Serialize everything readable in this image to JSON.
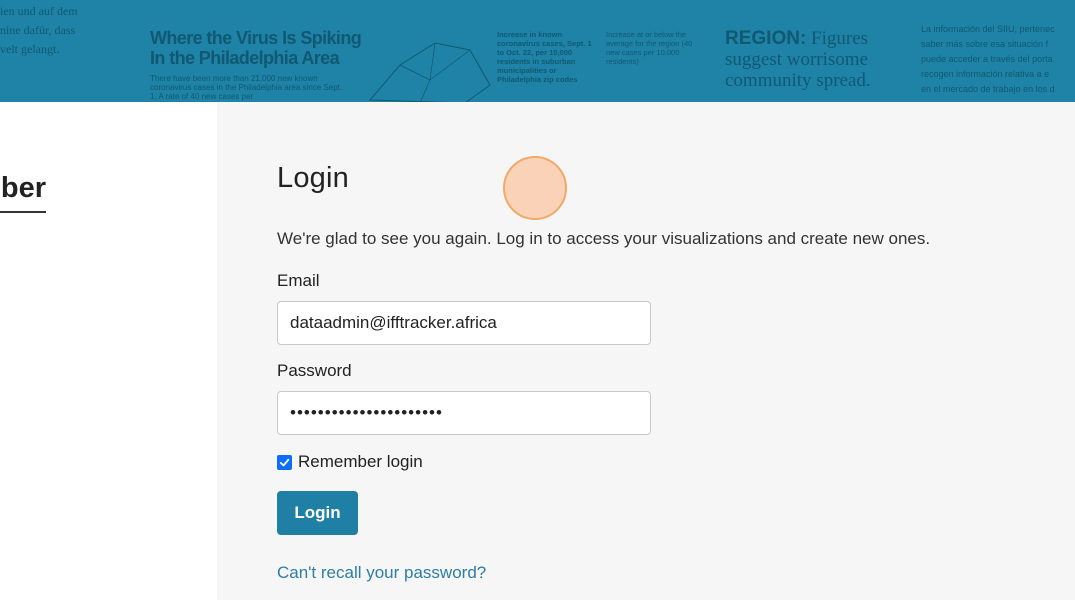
{
  "banner": {
    "german_lines": [
      "ien und auf dem",
      "nine dafür, dass",
      "velt gelangt."
    ],
    "headline_line1": "Where the Virus Is Spiking",
    "headline_line2": "In the Philadelphia Area",
    "subtext": "There have been more than 21,000 new known coronavirus cases in the Philadelphia area since Sept. 1. A rate of 40 new cases per",
    "stat_text": "Increase in known coronavirus cases, Sept. 1 to Oct. 22, per 10,000 residents in suburban municipalities or Philadelphia zip codes",
    "legend_text": "Increase at or below the average for the region (40 new cases per 10,000 residents)",
    "region_label": "REGION:",
    "region_line1": " Figures",
    "region_line2": "suggest worrisome",
    "region_line3": "community spread.",
    "spanish_lines": [
      "La información del SIIU, pertenec",
      "saber más sobre esa situación f",
      "puede acceder a través del porta",
      "recogen información relativa a e",
      "en el mercado de trabajo en los d"
    ]
  },
  "left_panel": {
    "title": "Become a member"
  },
  "login": {
    "title": "Login",
    "intro": "We're glad to see you again. Log in to access your visualizations and create new ones.",
    "email_label": "Email",
    "email_value": "dataadmin@ifftracker.africa",
    "password_label": "Password",
    "password_value": "••••••••••••••••••••••",
    "remember_label": "Remember login",
    "remember_checked": true,
    "button_label": "Login",
    "forgot_link": "Can't recall your password?"
  },
  "colors": {
    "banner": "#1e83a6",
    "button": "#1f7fa5",
    "link": "#2c7ea3",
    "panel": "#f6f6f6"
  }
}
